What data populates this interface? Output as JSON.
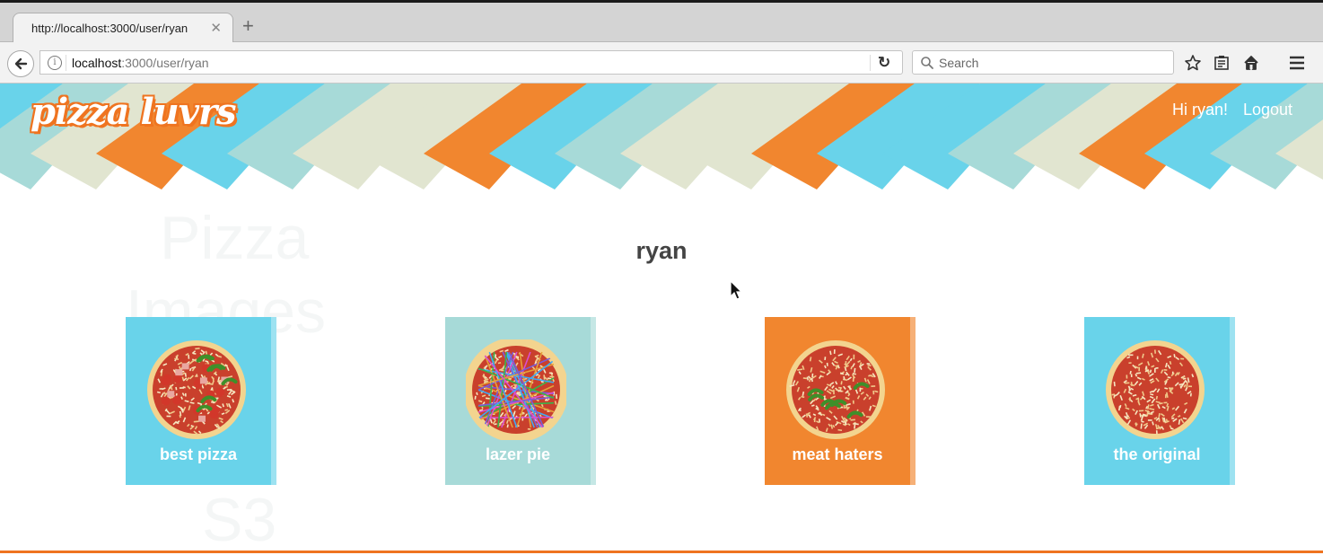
{
  "browser": {
    "tab_title": "http://localhost:3000/user/ryan",
    "tab_close": "✕",
    "new_tab": "+",
    "url_host": "localhost",
    "url_path": ":3000/user/ryan",
    "search_placeholder": "Search"
  },
  "header": {
    "logo_text": "pizza luvrs",
    "greeting": "Hi ryan!",
    "logout_label": "Logout",
    "stripe_colors": [
      "#e1e5d0",
      "#f1862f",
      "#69d3ea",
      "#a7dad8"
    ]
  },
  "background_text": [
    "Pizza",
    "Images",
    "S3"
  ],
  "profile": {
    "username": "ryan"
  },
  "pizzas": [
    {
      "name": "best pizza",
      "color": "#69d3ea",
      "toppings": "pepperoni-peppers"
    },
    {
      "name": "lazer pie",
      "color": "#a7dad8",
      "toppings": "lasers"
    },
    {
      "name": "meat haters",
      "color": "#f1862f",
      "toppings": "peppers"
    },
    {
      "name": "the original",
      "color": "#69d3ea",
      "toppings": "cheese"
    }
  ]
}
